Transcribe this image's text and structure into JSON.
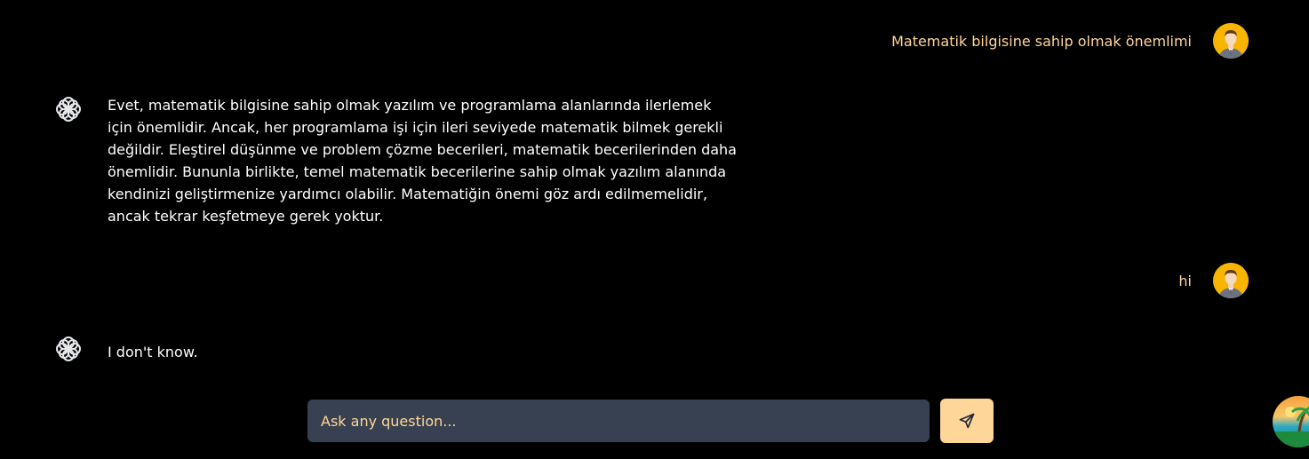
{
  "conversation": {
    "messages": [
      {
        "role": "user",
        "text": "Matematik bilgisine sahip olmak önemlimi"
      },
      {
        "role": "assistant",
        "text": "Evet, matematik bilgisine sahip olmak yazılım ve programlama alanlarında ilerlemek için önemlidir. Ancak, her programlama işi için ileri seviyede matematik bilmek gerekli değildir. Eleştirel düşünme ve problem çözme becerileri, matematik becerilerinden daha önemlidir. Bununla birlikte, temel matematik becerilerine sahip olmak yazılım alanında kendinizi geliştirmenize yardımcı olabilir. Matematiğin önemi göz ardı edilmemelidir, ancak tekrar keşfetmeye gerek yoktur."
      },
      {
        "role": "user",
        "text": "hi"
      },
      {
        "role": "assistant",
        "text": "I don't know."
      }
    ]
  },
  "composer": {
    "placeholder": "Ask any question...",
    "value": "",
    "send_icon": "send-icon"
  },
  "icons": {
    "user_avatar": "user-avatar-icon",
    "assistant": "openai-logo-icon"
  },
  "colors": {
    "background": "#000000",
    "user_text": "#ffd699",
    "assistant_text": "#ffffff",
    "input_bg": "#374151",
    "send_button": "#ffd699",
    "avatar_bg": "#f7b500"
  }
}
